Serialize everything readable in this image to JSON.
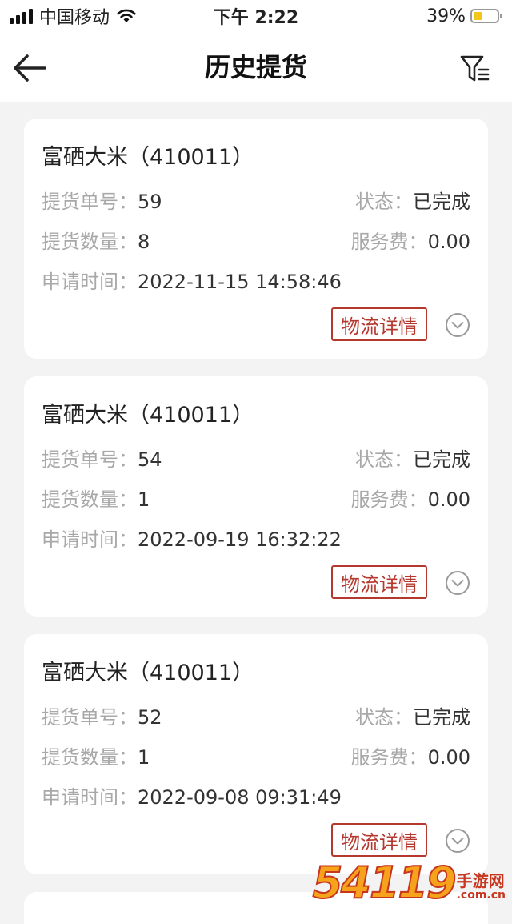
{
  "status_bar": {
    "carrier": "中国移动",
    "time": "下午 2:22",
    "battery_percent": "39%",
    "battery_level": 0.39,
    "battery_color": "#f5c518",
    "wifi_icon": "wifi-icon"
  },
  "nav": {
    "title": "历史提货",
    "back_icon": "back-arrow-icon",
    "filter_icon": "filter-icon"
  },
  "labels": {
    "order_no": "提货单号：",
    "status": "状态：",
    "quantity": "提货数量：",
    "service_fee": "服务费：",
    "apply_time": "申请时间：",
    "logistics_button": "物流详情"
  },
  "orders": [
    {
      "product": "富硒大米（410011）",
      "order_no": "59",
      "status": "已完成",
      "quantity": "8",
      "service_fee": "0.00",
      "apply_time": "2022-11-15 14:58:46"
    },
    {
      "product": "富硒大米（410011）",
      "order_no": "54",
      "status": "已完成",
      "quantity": "1",
      "service_fee": "0.00",
      "apply_time": "2022-09-19 16:32:22"
    },
    {
      "product": "富硒大米（410011）",
      "order_no": "52",
      "status": "已完成",
      "quantity": "1",
      "service_fee": "0.00",
      "apply_time": "2022-09-08 09:31:49"
    }
  ],
  "watermark": {
    "big": "54119",
    "cn": "手游网",
    "url": ".com.cn"
  },
  "colors": {
    "accent_red": "#b5382e",
    "label_gray": "#a8a8a8",
    "page_bg": "#f3f3f3"
  }
}
